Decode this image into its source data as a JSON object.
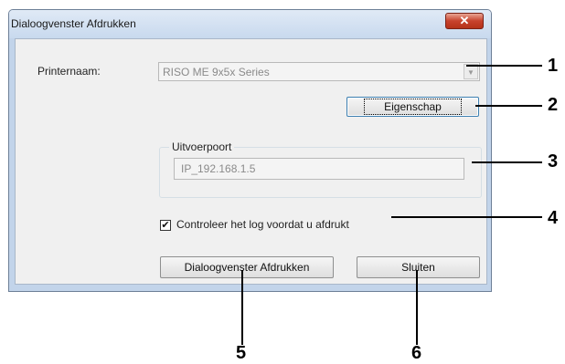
{
  "window": {
    "title": "Dialoogvenster Afdrukken",
    "close_glyph": "✕"
  },
  "printer": {
    "label": "Printernaam:",
    "value": "RISO ME 9x5x Series",
    "arrow": "▼"
  },
  "property_button": "Eigenschap",
  "output_port": {
    "group_title": "Uitvoerpoort",
    "value": "IP_192.168.1.5"
  },
  "log_check": {
    "checked": true,
    "mark": "✔",
    "label": "Controleer het log voordat u afdrukt"
  },
  "print_button": "Dialoogvenster Afdrukken",
  "close_button": "Sluiten",
  "callouts": [
    "1",
    "2",
    "3",
    "4",
    "5",
    "6"
  ]
}
